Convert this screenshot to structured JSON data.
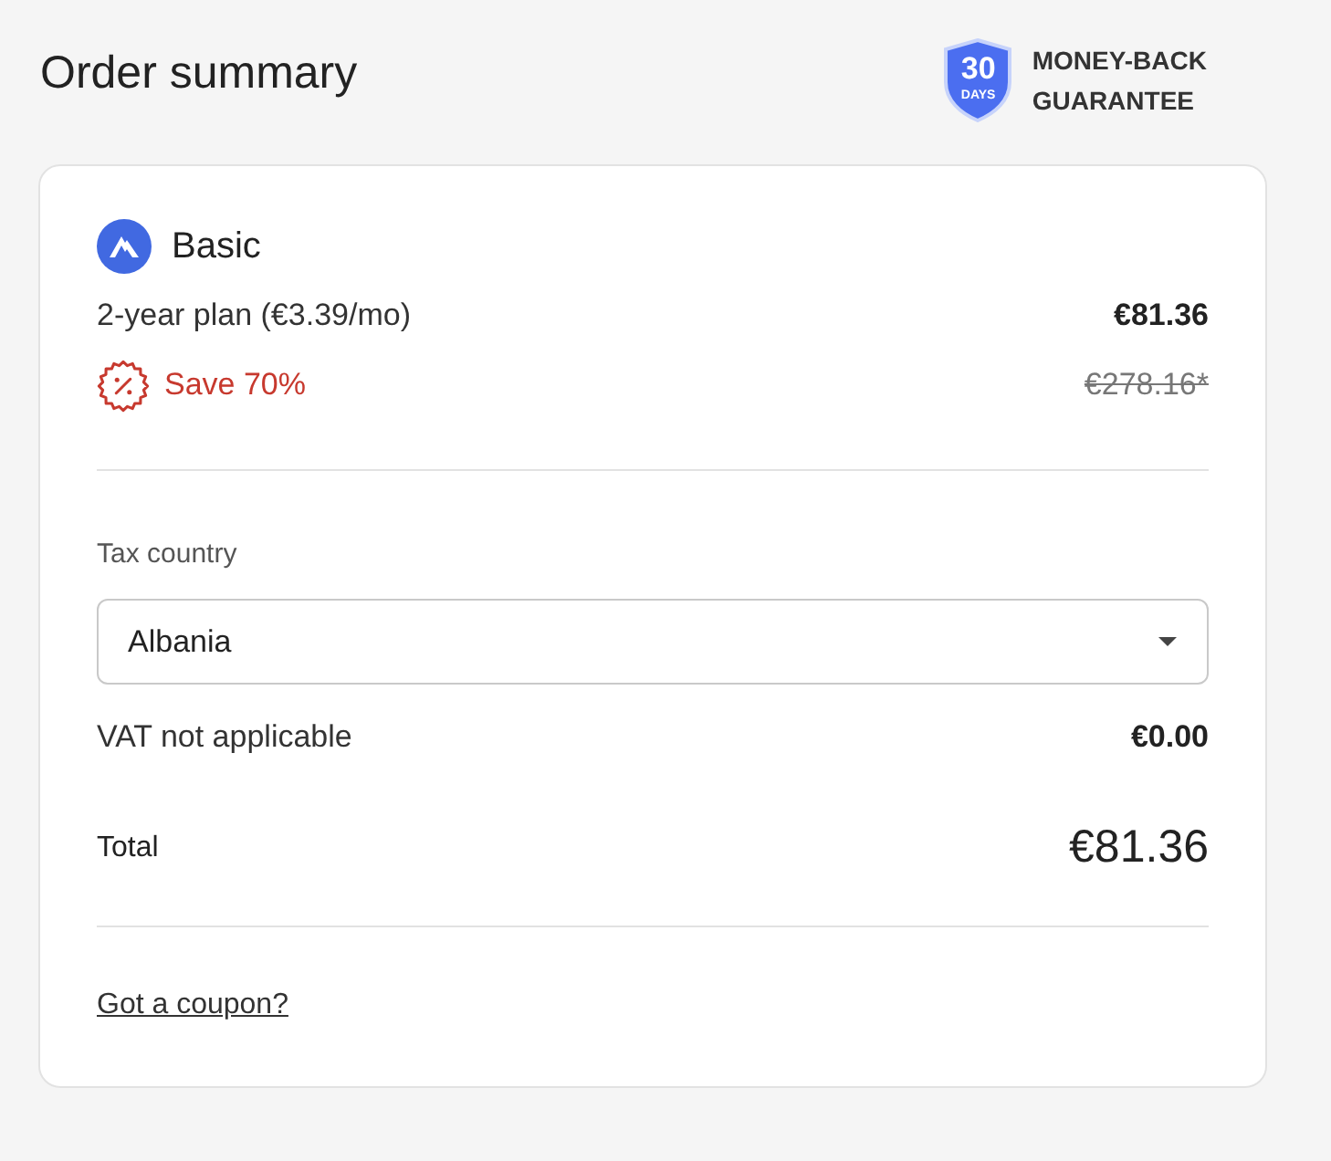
{
  "title": "Order summary",
  "guarantee": {
    "badge_number": "30",
    "badge_unit": "DAYS",
    "label_lines": [
      "MONEY-BACK",
      "GUARANTEE"
    ]
  },
  "product": {
    "name": "Basic"
  },
  "plan": {
    "label": "2-year plan (€3.39/mo)",
    "price": "€81.36"
  },
  "discount": {
    "label": "Save 70%",
    "original_price": "€278.16*"
  },
  "tax": {
    "label": "Tax country",
    "selected_country": "Albania"
  },
  "vat": {
    "label": "VAT not applicable",
    "amount": "€0.00"
  },
  "total": {
    "label": "Total",
    "amount": "€81.36"
  },
  "coupon_link": "Got a coupon?"
}
